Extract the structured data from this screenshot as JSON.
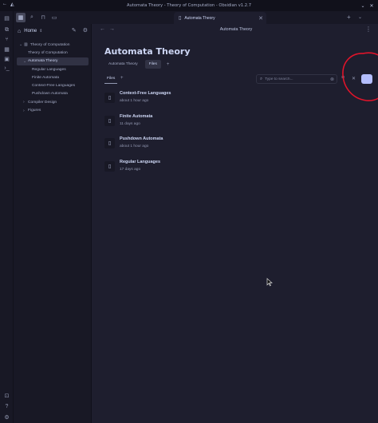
{
  "window": {
    "title": "Automata Theory - Theory of Computation - Obsidian v1.2.7"
  },
  "tabbar": {
    "active_tab": "Automata Theory"
  },
  "sidebar": {
    "home_label": "Home",
    "tree": [
      {
        "label": "Theory of Computation",
        "level": 0,
        "kind": "folder-open"
      },
      {
        "label": "Theory of Computation",
        "level": 1,
        "kind": "note"
      },
      {
        "label": "Automata Theory",
        "level": 1,
        "kind": "folder-open",
        "selected": true
      },
      {
        "label": "Regular Languages",
        "level": 2,
        "kind": "note"
      },
      {
        "label": "Finite Automata",
        "level": 2,
        "kind": "note"
      },
      {
        "label": "Context-Free Languages",
        "level": 2,
        "kind": "note"
      },
      {
        "label": "Pushdown Automata",
        "level": 2,
        "kind": "note"
      },
      {
        "label": "Compiler Design",
        "level": 1,
        "kind": "folder-closed"
      },
      {
        "label": "Figures",
        "level": 1,
        "kind": "folder-closed"
      }
    ]
  },
  "main": {
    "breadcrumb": "Automata Theory",
    "page_title": "Automata Theory",
    "view_tabs": [
      {
        "label": "Automata Theory",
        "active": false
      },
      {
        "label": "Files",
        "active": true
      }
    ],
    "files_tab_label": "Files",
    "search": {
      "placeholder": "Type to search...",
      "value": ""
    },
    "files": [
      {
        "name": "Context-Free Languages",
        "modified": "about 1 hour ago"
      },
      {
        "name": "Finite Automata",
        "modified": "11 days ago"
      },
      {
        "name": "Pushdown Automata",
        "modified": "about 1 hour ago"
      },
      {
        "name": "Regular Languages",
        "modified": "17 days ago"
      }
    ]
  },
  "colors": {
    "background": "#1e1e2e",
    "sidebar": "#181825",
    "accent": "#b4befe",
    "annotation": "#e0142a"
  },
  "icons": {
    "ribbon": [
      "files-icon",
      "graph-icon",
      "canvas-icon",
      "calendar-icon",
      "terminal-icon",
      "vault-icon",
      "help-icon",
      "settings-icon"
    ]
  }
}
